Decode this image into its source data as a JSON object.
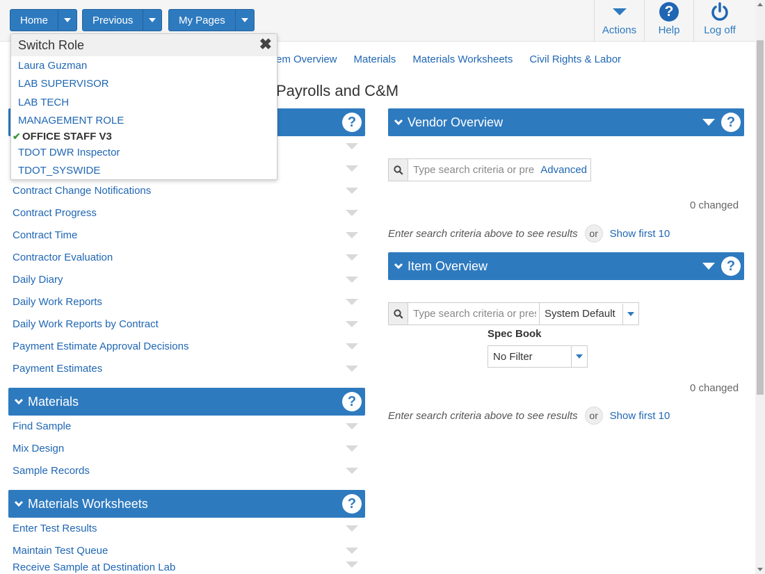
{
  "nav": {
    "home": "Home",
    "previous": "Previous",
    "mypages": "My Pages",
    "actions": "Actions",
    "help": "Help",
    "logoff": "Log off"
  },
  "tabs": [
    "em Overview",
    "Materials",
    "Materials Worksheets",
    "Civil Rights & Labor"
  ],
  "page_title": "Payrolls and C&M",
  "switch_role": {
    "title": "Switch Role",
    "items": [
      "Laura Guzman",
      "LAB SUPERVISOR",
      "LAB TECH",
      "MANAGEMENT ROLE"
    ],
    "selected": "OFFICE STAFF V3",
    "items_after": [
      "TDOT DWR Inspector",
      "TDOT_SYSWIDE"
    ]
  },
  "left": {
    "first_list": [
      "Contract Change Notifications",
      "Contract Progress",
      "Contract Time",
      "Contractor Evaluation",
      "Daily Diary",
      "Daily Work Reports",
      "Daily Work Reports by Contract",
      "Payment Estimate Approval Decisions",
      "Payment Estimates"
    ],
    "materials": {
      "title": "Materials",
      "items": [
        "Find Sample",
        "Mix Design",
        "Sample Records"
      ]
    },
    "materials_ws": {
      "title": "Materials Worksheets",
      "items": [
        "Enter Test Results",
        "Maintain Test Queue",
        "Receive Sample at Destination Lab"
      ]
    }
  },
  "vendor": {
    "title": "Vendor Overview",
    "search_placeholder": "Type search criteria or press Enter",
    "advanced": "Advanced",
    "changed": "0 changed",
    "hint": "Enter search criteria above to see results",
    "or": "or",
    "show_first": "Show first 10"
  },
  "item": {
    "title": "Item Overview",
    "search_placeholder": "Type search criteria or press Enter",
    "system_default": "System Default",
    "spec_book_label": "Spec Book",
    "spec_book_value": "No Filter",
    "changed": "0 changed",
    "hint": "Enter search criteria above to see results",
    "or": "or",
    "show_first": "Show first 10"
  },
  "help_glyph": "?",
  "colors": {
    "accent": "#2e7abf",
    "link": "#1f66b3"
  },
  "icons": [
    "caret-down-icon",
    "help-icon",
    "power-icon",
    "search-icon",
    "chevron-down-icon",
    "close-icon",
    "check-icon"
  ]
}
